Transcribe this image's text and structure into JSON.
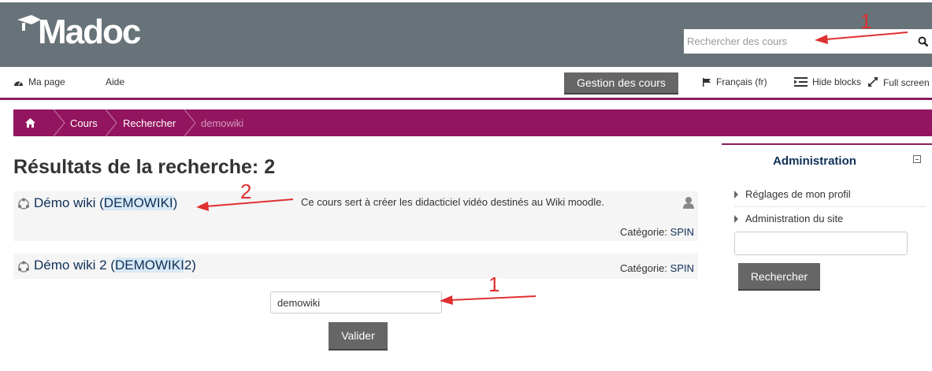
{
  "header": {
    "logo_text": "Madoc",
    "search_placeholder": "Rechercher des cours"
  },
  "navbar": {
    "my_page": "Ma page",
    "help": "Aide",
    "manage_courses": "Gestion des cours",
    "language": "Français (fr)",
    "hide_blocks": "Hide blocks",
    "full_screen": "Full screen"
  },
  "breadcrumb": {
    "items": [
      "Cours",
      "Rechercher"
    ],
    "current": "demowiki"
  },
  "main": {
    "title": "Résultats de la recherche: 2",
    "results": [
      {
        "name_prefix": "Démo wiki (",
        "name_highlight": "DEMOWIKI",
        "name_suffix": ")",
        "summary": "Ce cours sert à créer les didacticiel vidéo destinés au Wiki moodle.",
        "category_label": "Catégorie:",
        "category": "SPIN"
      },
      {
        "name_prefix": "Démo wiki 2 (",
        "name_highlight": "DEMOWIKI",
        "name_suffix": "2)",
        "summary": "",
        "category_label": "Catégorie:",
        "category": "SPIN"
      }
    ],
    "search_value": "demowiki",
    "submit_label": "Valider"
  },
  "admin_block": {
    "title": "Administration",
    "items": [
      "Réglages de mon profil",
      "Administration du site"
    ],
    "search_value": "",
    "search_button": "Rechercher"
  },
  "annotations": {
    "top_search": "1",
    "course_code": "2",
    "main_search": "1"
  },
  "colors": {
    "header_bg": "#677379",
    "brand_purple": "#93155f",
    "link": "#0f2f57",
    "annotation": "#e03030"
  }
}
